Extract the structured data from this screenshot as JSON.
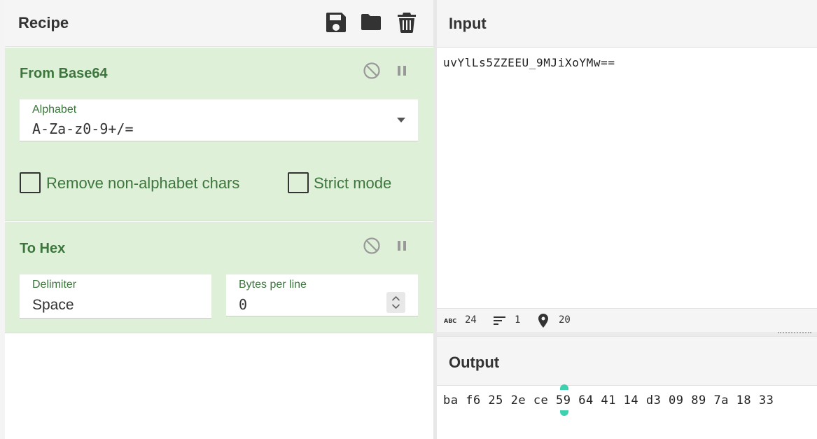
{
  "recipe": {
    "title": "Recipe",
    "operations": [
      {
        "name": "From Base64",
        "alphabet_label": "Alphabet",
        "alphabet_value": "A-Za-z0-9+/=",
        "remove_nonalpha_label": "Remove non-alphabet chars",
        "strict_mode_label": "Strict mode"
      },
      {
        "name": "To Hex",
        "delimiter_label": "Delimiter",
        "delimiter_value": "Space",
        "bytes_per_line_label": "Bytes per line",
        "bytes_per_line_value": "0"
      }
    ]
  },
  "input": {
    "title": "Input",
    "text": "uvYlLs5ZZEEU_9MJiXoYMw==",
    "stats": {
      "length": "24",
      "lines": "1",
      "cursor": "20"
    }
  },
  "output": {
    "title": "Output",
    "text": "ba f6 25 2e ce 59 64 41 14 d3 09 89 7a 18 33"
  },
  "colors": {
    "op_background": "#dff0d8",
    "op_title": "#3c763d",
    "header_background": "#f5f5f5",
    "selection_handle": "#3fd0b0"
  }
}
